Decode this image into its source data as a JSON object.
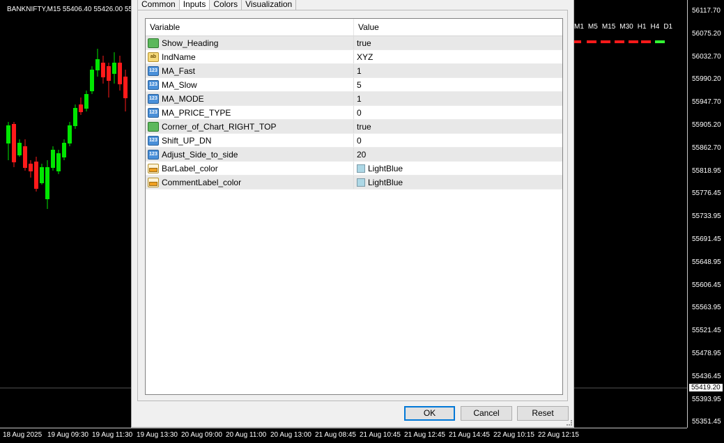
{
  "chart": {
    "title": "BANKNIFTY,M15  55406.40 55426.00 55",
    "timeframes": [
      "M1",
      "M5",
      "M15",
      "M30",
      "H1",
      "H4",
      "D1"
    ],
    "prices": [
      "56117.70",
      "56075.20",
      "56032.70",
      "55990.20",
      "55947.70",
      "55905.20",
      "55862.70",
      "55818.95",
      "55776.45",
      "55733.95",
      "55691.45",
      "55648.95",
      "55606.45",
      "55563.95",
      "55521.45",
      "55478.95",
      "55436.45",
      "55393.95",
      "55351.45"
    ],
    "current_price": "55419.20",
    "times": [
      "18 Aug 2025",
      "19 Aug 09:30",
      "19 Aug 11:30",
      "19 Aug 13:30",
      "20 Aug 09:00",
      "20 Aug 11:00",
      "20 Aug 13:00",
      "21 Aug 08:45",
      "21 Aug 10:45",
      "21 Aug 12:45",
      "21 Aug 14:45",
      "22 Aug 10:15",
      "22 Aug 12:15"
    ],
    "colors": {
      "bull": "#00e600",
      "bear": "#ff1a1a",
      "dash_red": "#ff1a1a",
      "dash_green": "#33ff33"
    }
  },
  "dialog": {
    "tabs": [
      "Common",
      "Inputs",
      "Colors",
      "Visualization"
    ],
    "active_tab": "Inputs",
    "columns": {
      "variable": "Variable",
      "value": "Value"
    },
    "rows": [
      {
        "icon": "bool",
        "name": "Show_Heading",
        "value": "true"
      },
      {
        "icon": "str",
        "name": "IndName",
        "value": "XYZ"
      },
      {
        "icon": "num",
        "name": "MA_Fast",
        "value": "1"
      },
      {
        "icon": "num",
        "name": "MA_Slow",
        "value": "5"
      },
      {
        "icon": "num",
        "name": "MA_MODE",
        "value": "1"
      },
      {
        "icon": "num",
        "name": "MA_PRICE_TYPE",
        "value": "0"
      },
      {
        "icon": "bool",
        "name": "Corner_of_Chart_RIGHT_TOP",
        "value": "true"
      },
      {
        "icon": "num",
        "name": "Shift_UP_DN",
        "value": "0"
      },
      {
        "icon": "num",
        "name": "Adjust_Side_to_side",
        "value": "20"
      },
      {
        "icon": "col",
        "name": "BarLabel_color",
        "value": "LightBlue",
        "swatch": "#add8e6"
      },
      {
        "icon": "col",
        "name": "CommentLabel_color",
        "value": "LightBlue",
        "swatch": "#add8e6"
      }
    ],
    "buttons": {
      "ok": "OK",
      "cancel": "Cancel",
      "reset": "Reset"
    }
  }
}
